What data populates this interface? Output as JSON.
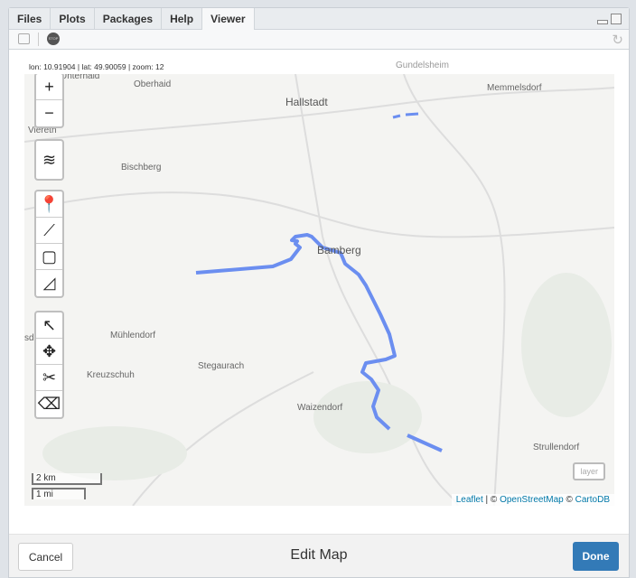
{
  "tabs": [
    "Files",
    "Plots",
    "Packages",
    "Help",
    "Viewer"
  ],
  "coords": "lon: 10.91904 | lat: 49.90059 | zoom: 12",
  "map_labels": {
    "gundelsheim": "Gundelsheim",
    "unterhaid": "Unterhaid",
    "oberhaid": "Oberhaid",
    "hallstadt": "Hallstadt",
    "memmelsdorf": "Memmelsdorf",
    "viereth": "Viereth",
    "bischberg": "Bischberg",
    "bamberg": "Bamberg",
    "dorf": "sdorf",
    "muehlendorf": "Mühlendorf",
    "kreuzschuh": "Kreuzschuh",
    "stegaurach": "Stegaurach",
    "waizendorf": "Waizendorf",
    "strullendorf": "Strullendorf"
  },
  "controls": {
    "zoom_in": "+",
    "zoom_out": "−"
  },
  "scale": {
    "km": "2 km",
    "mi": "1 mi"
  },
  "layer_button": "layer",
  "attribution": {
    "leaflet": "Leaflet",
    "sep": " | © ",
    "osm": "OpenStreetMap",
    "copy": " © ",
    "carto": "CartoDB"
  },
  "footer": {
    "cancel": "Cancel",
    "title": "Edit Map",
    "done": "Done"
  },
  "colors": {
    "route": "#6b8ef0",
    "done": "#337ab7"
  }
}
